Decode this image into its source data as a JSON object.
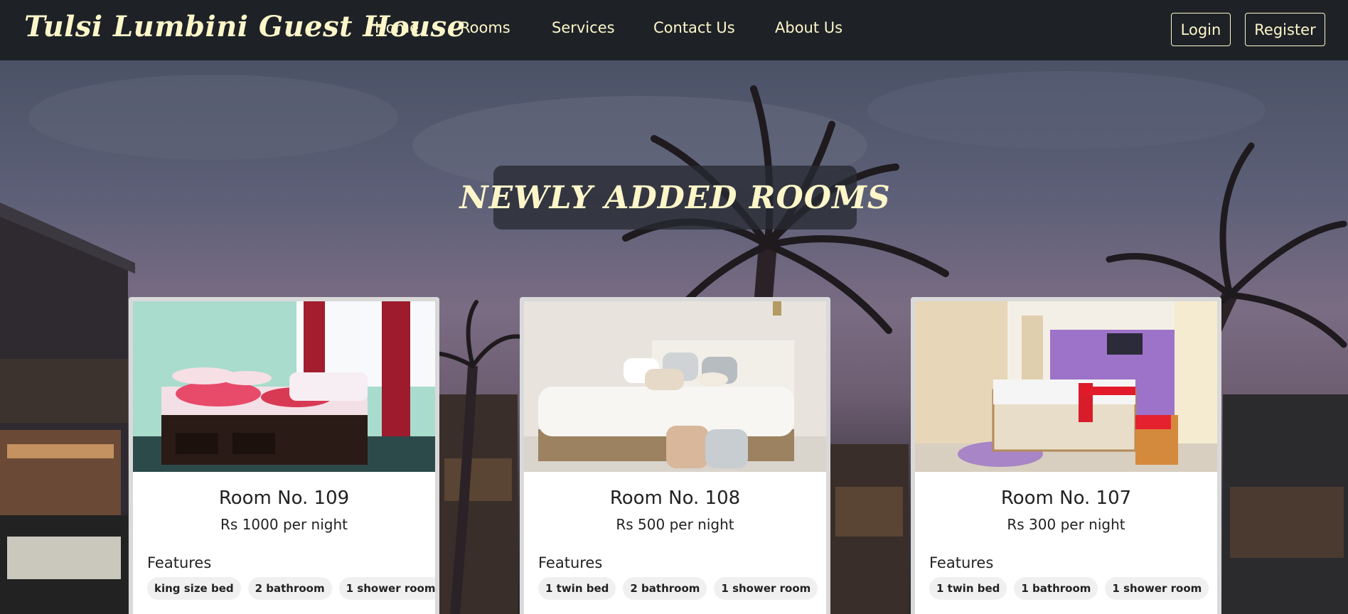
{
  "brand": "Tulsi Lumbini Guest House",
  "nav": {
    "links": [
      "Home",
      "Rooms",
      "Services",
      "Contact Us",
      "About Us"
    ],
    "login": "Login",
    "register": "Register"
  },
  "hero": {
    "heading": "NEWLY ADDED ROOMS"
  },
  "rooms": [
    {
      "title": "Room No. 109",
      "price": "Rs 1000 per night",
      "features_label": "Features",
      "features": [
        "king size bed",
        "2 bathroom",
        "1 shower room"
      ]
    },
    {
      "title": "Room No. 108",
      "price": "Rs 500 per night",
      "features_label": "Features",
      "features": [
        "1 twin bed",
        "2 bathroom",
        "1 shower room"
      ]
    },
    {
      "title": "Room No. 107",
      "price": "Rs 300 per night",
      "features_label": "Features",
      "features": [
        "1 twin bed",
        "1 bathroom",
        "1 shower room"
      ]
    }
  ],
  "colors": {
    "navbar": "#1e2227",
    "accent_text": "#fdf6c9"
  }
}
